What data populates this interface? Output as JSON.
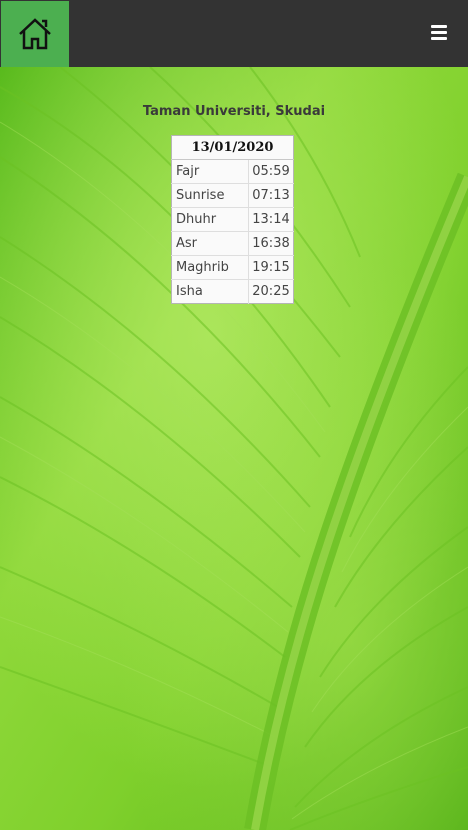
{
  "header": {
    "home_icon": "home-icon",
    "menu_icon": "hamburger-menu-icon",
    "home_color": "#4caf50",
    "bar_color": "#333333"
  },
  "location": "Taman Universiti, Skudai",
  "prayer_table": {
    "date": "13/01/2020",
    "rows": [
      {
        "name": "Fajr",
        "time": "05:59"
      },
      {
        "name": "Sunrise",
        "time": "07:13"
      },
      {
        "name": "Dhuhr",
        "time": "13:14"
      },
      {
        "name": "Asr",
        "time": "16:38"
      },
      {
        "name": "Maghrib",
        "time": "19:15"
      },
      {
        "name": "Isha",
        "time": "20:25"
      }
    ]
  },
  "background": "green-leaf-image"
}
